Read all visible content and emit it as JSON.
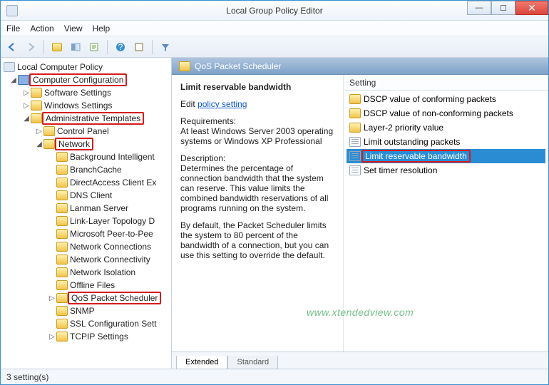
{
  "window": {
    "title": "Local Group Policy Editor"
  },
  "menus": [
    "File",
    "Action",
    "View",
    "Help"
  ],
  "tree": {
    "root": "Local Computer Policy",
    "cc": "Computer Configuration",
    "sws": "Software Settings",
    "wws": "Windows Settings",
    "adm": "Administrative Templates",
    "cp": "Control Panel",
    "net": "Network",
    "children": [
      "Background Intelligent",
      "BranchCache",
      "DirectAccess Client Ex",
      "DNS Client",
      "Lanman Server",
      "Link-Layer Topology D",
      "Microsoft Peer-to-Pee",
      "Network Connections",
      "Network Connectivity",
      "Network Isolation",
      "Offline Files",
      "QoS Packet Scheduler",
      "SNMP",
      "SSL Configuration Sett",
      "TCPIP Settings"
    ]
  },
  "header": {
    "title": "QoS Packet Scheduler"
  },
  "details": {
    "title": "Limit reservable bandwidth",
    "edit_prefix": "Edit ",
    "edit_link": "policy setting",
    "req_label": "Requirements:",
    "req_text": "At least Windows Server 2003 operating systems or Windows XP Professional",
    "desc_label": "Description:",
    "desc_text": "Determines the percentage of connection bandwidth that the system can reserve. This value limits the combined bandwidth reservations of all programs running on the system.",
    "desc_text2": "By default, the Packet Scheduler limits the system to 80 percent of the bandwidth of a connection, but you can use this setting to override the default."
  },
  "col": {
    "setting": "Setting"
  },
  "settings": [
    {
      "label": "DSCP value of conforming packets",
      "type": "folder"
    },
    {
      "label": "DSCP value of non-conforming packets",
      "type": "folder"
    },
    {
      "label": "Layer-2 priority value",
      "type": "folder"
    },
    {
      "label": "Limit outstanding packets",
      "type": "setting"
    },
    {
      "label": "Limit reservable bandwidth",
      "type": "setting",
      "selected": true
    },
    {
      "label": "Set timer resolution",
      "type": "setting"
    }
  ],
  "tabs": {
    "extended": "Extended",
    "standard": "Standard"
  },
  "status": "3 setting(s)",
  "watermark": "www.xtendedview.com"
}
